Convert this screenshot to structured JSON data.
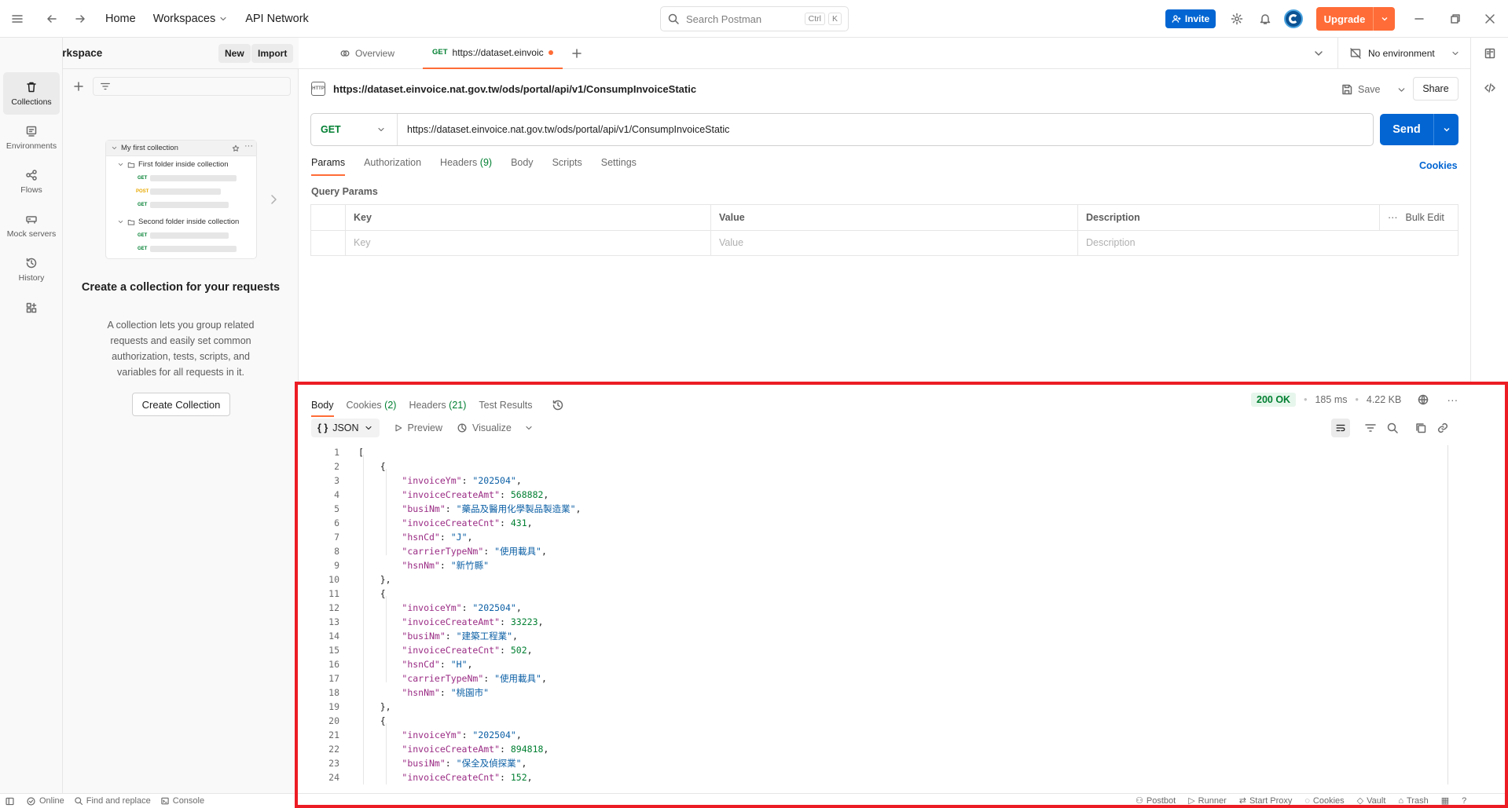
{
  "topbar": {
    "home": "Home",
    "workspaces": "Workspaces",
    "api_network": "API Network",
    "search_placeholder": "Search Postman",
    "search_kbd_ctrl": "Ctrl",
    "search_kbd_k": "K",
    "invite": "Invite",
    "upgrade": "Upgrade"
  },
  "workspace": {
    "name": "My Workspace",
    "new_label": "New",
    "import_label": "Import"
  },
  "rail": [
    {
      "label": "Collections",
      "icon": "trash-can-icon"
    },
    {
      "label": "Environments",
      "icon": "environment-icon"
    },
    {
      "label": "Flows",
      "icon": "flows-icon"
    },
    {
      "label": "Mock servers",
      "icon": "mock-server-icon"
    },
    {
      "label": "History",
      "icon": "history-icon"
    }
  ],
  "sidebar": {
    "illus_collection": "My first collection",
    "illus_folder1": "First folder inside collection",
    "illus_folder2": "Second folder inside collection",
    "illus_get": "GET",
    "illus_post": "POST",
    "empty_title": "Create a collection for your requests",
    "empty_desc": "A collection lets you group related requests and easily set common authorization, tests, scripts, and variables for all requests in it.",
    "create_button": "Create Collection"
  },
  "tabs": {
    "overview": "Overview",
    "active_method": "GET",
    "active_title": "https://dataset.einvoic",
    "environment": "No environment"
  },
  "request": {
    "title": "https://dataset.einvoice.nat.gov.tw/ods/portal/api/v1/ConsumpInvoiceStatic",
    "method": "GET",
    "url": "https://dataset.einvoice.nat.gov.tw/ods/portal/api/v1/ConsumpInvoiceStatic",
    "save": "Save",
    "share": "Share",
    "send": "Send",
    "tabs": [
      "Params",
      "Authorization",
      "Headers",
      "Body",
      "Scripts",
      "Settings"
    ],
    "headers_count": "(9)",
    "cookies": "Cookies",
    "query_params_title": "Query Params",
    "columns": [
      "Key",
      "Value",
      "Description"
    ],
    "bulk_edit": "Bulk Edit",
    "placeholders": [
      "Key",
      "Value",
      "Description"
    ]
  },
  "response": {
    "tabs": [
      "Body",
      "Cookies",
      "Headers",
      "Test Results"
    ],
    "cookies_count": "(2)",
    "headers_count": "(21)",
    "status": "200 OK",
    "time": "185 ms",
    "size": "4.22 KB",
    "format": "JSON",
    "preview": "Preview",
    "visualize": "Visualize",
    "lines": [
      "[",
      "    {",
      "        \"invoiceYm\": \"202504\",",
      "        \"invoiceCreateAmt\": 568882,",
      "        \"busiNm\": \"藥品及醫用化學製品製造業\",",
      "        \"invoiceCreateCnt\": 431,",
      "        \"hsnCd\": \"J\",",
      "        \"carrierTypeNm\": \"使用載具\",",
      "        \"hsnNm\": \"新竹縣\"",
      "    },",
      "    {",
      "        \"invoiceYm\": \"202504\",",
      "        \"invoiceCreateAmt\": 33223,",
      "        \"busiNm\": \"建築工程業\",",
      "        \"invoiceCreateCnt\": 502,",
      "        \"hsnCd\": \"H\",",
      "        \"carrierTypeNm\": \"使用載具\",",
      "        \"hsnNm\": \"桃園市\"",
      "    },",
      "    {",
      "        \"invoiceYm\": \"202504\",",
      "        \"invoiceCreateAmt\": 894818,",
      "        \"busiNm\": \"保全及偵探業\",",
      "        \"invoiceCreateCnt\": 152,"
    ]
  },
  "statusbar": {
    "online": "Online",
    "find_replace": "Find and replace",
    "console": "Console",
    "postbot": "Postbot",
    "runner": "Runner",
    "start_proxy": "Start Proxy",
    "cookies": "Cookies",
    "vault": "Vault",
    "trash": "Trash"
  },
  "colors": {
    "accent": "#ff6c37",
    "primary": "#0265d2",
    "get_green": "#007f31",
    "highlight": "#ec1c24"
  }
}
